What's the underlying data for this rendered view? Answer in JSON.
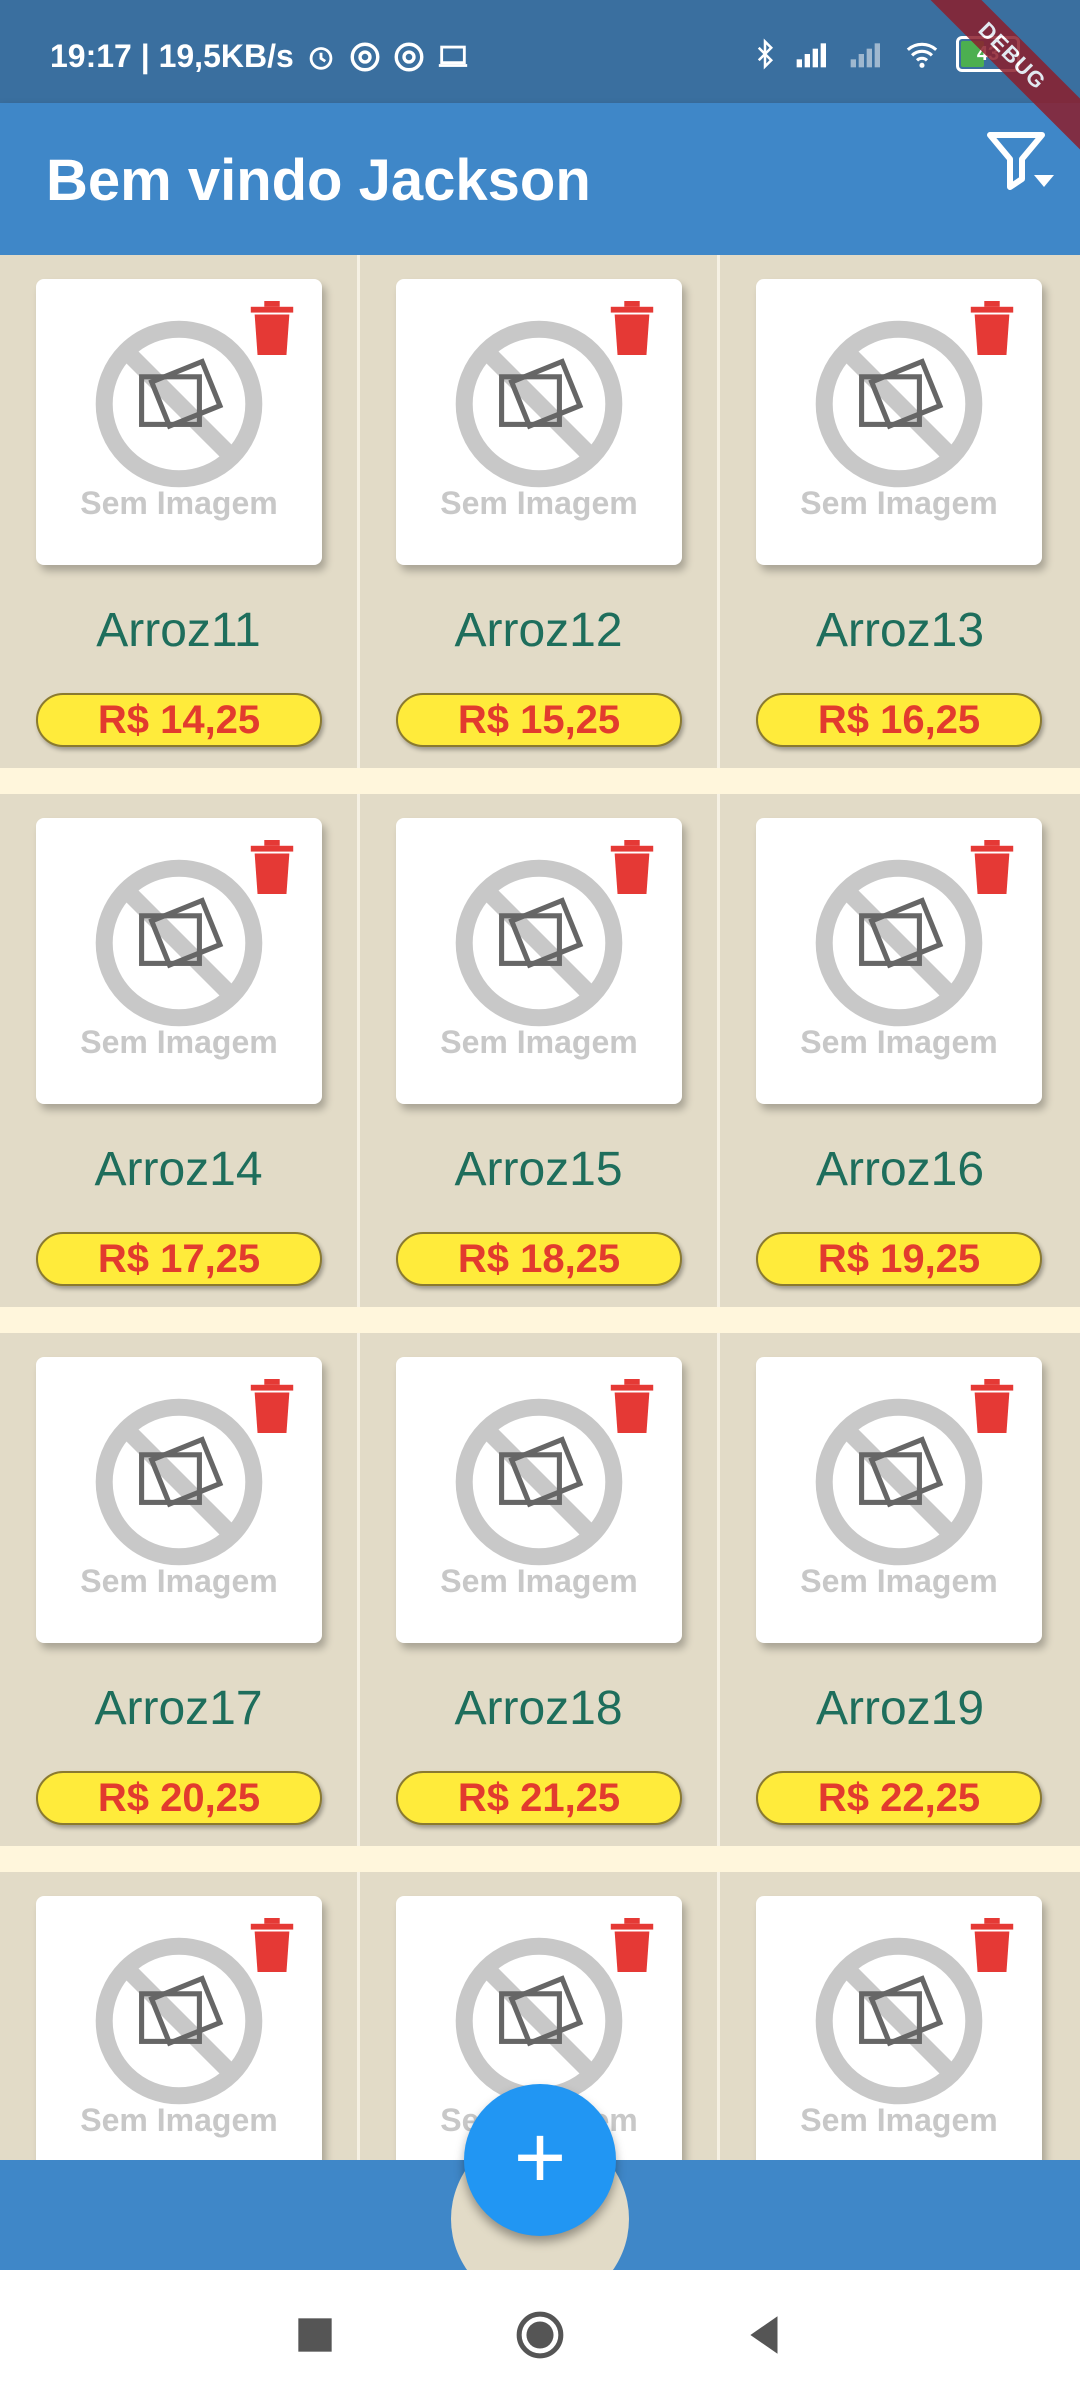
{
  "status_bar": {
    "time_speed": "19:17 | 19,5KB/s",
    "battery": "43",
    "debug_label": "DEBUG"
  },
  "app_bar": {
    "title": "Bem vindo Jackson"
  },
  "placeholder_text": "Sem Imagem",
  "products": [
    {
      "name": "Arroz11",
      "price": "R$ 14,25"
    },
    {
      "name": "Arroz12",
      "price": "R$ 15,25"
    },
    {
      "name": "Arroz13",
      "price": "R$ 16,25"
    },
    {
      "name": "Arroz14",
      "price": "R$ 17,25"
    },
    {
      "name": "Arroz15",
      "price": "R$ 18,25"
    },
    {
      "name": "Arroz16",
      "price": "R$ 19,25"
    },
    {
      "name": "Arroz17",
      "price": "R$ 20,25"
    },
    {
      "name": "Arroz18",
      "price": "R$ 21,25"
    },
    {
      "name": "Arroz19",
      "price": "R$ 22,25"
    },
    {
      "name": "",
      "price": ""
    },
    {
      "name": "",
      "price": ""
    },
    {
      "name": "",
      "price": ""
    }
  ],
  "fab": {
    "label": "+"
  },
  "colors": {
    "app_bar": "#3f87c8",
    "status_bar": "#3a6f9f",
    "fab": "#2196f3",
    "price_bg": "#ffeb3b",
    "price_text": "#e23b2e",
    "name_text": "#1e6e5c",
    "trash": "#e53935"
  },
  "icons": {
    "filter": "filter-dropdown-icon",
    "trash": "trash-icon",
    "no_image": "no-image-icon"
  }
}
